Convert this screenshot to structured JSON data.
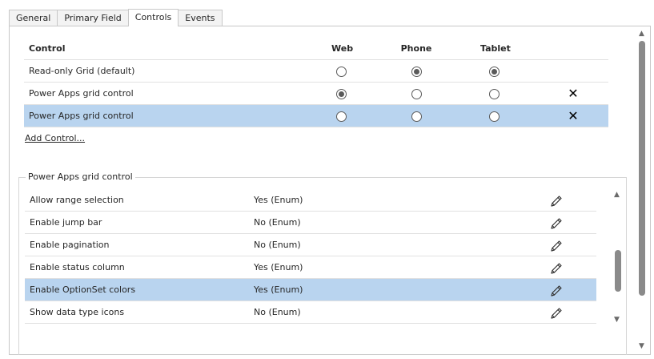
{
  "tabs": [
    {
      "label": "General",
      "active": false
    },
    {
      "label": "Primary Field",
      "active": false
    },
    {
      "label": "Controls",
      "active": true
    },
    {
      "label": "Events",
      "active": false
    }
  ],
  "controls_table": {
    "headers": {
      "control": "Control",
      "web": "Web",
      "phone": "Phone",
      "tablet": "Tablet"
    },
    "rows": [
      {
        "name": "Read-only Grid (default)",
        "web": false,
        "phone": true,
        "tablet": true,
        "removable": false,
        "selected": false
      },
      {
        "name": "Power Apps grid control",
        "web": true,
        "phone": false,
        "tablet": false,
        "removable": true,
        "selected": false
      },
      {
        "name": "Power Apps grid control",
        "web": false,
        "phone": false,
        "tablet": false,
        "removable": true,
        "selected": true
      }
    ],
    "delete_icon": "close-icon"
  },
  "add_control_label": "Add Control...",
  "properties": {
    "legend": "Power Apps grid control",
    "rows": [
      {
        "name": "Allow range selection",
        "value": "Yes (Enum)",
        "selected": false
      },
      {
        "name": "Enable jump bar",
        "value": "No (Enum)",
        "selected": false
      },
      {
        "name": "Enable pagination",
        "value": "No (Enum)",
        "selected": false
      },
      {
        "name": "Enable status column",
        "value": "Yes (Enum)",
        "selected": false
      },
      {
        "name": "Enable OptionSet colors",
        "value": "Yes (Enum)",
        "selected": true
      },
      {
        "name": "Show data type icons",
        "value": "No (Enum)",
        "selected": false
      }
    ],
    "edit_icon": "pencil-icon"
  },
  "colors": {
    "selection": "#b9d4ef",
    "border": "#c8c8c8"
  }
}
